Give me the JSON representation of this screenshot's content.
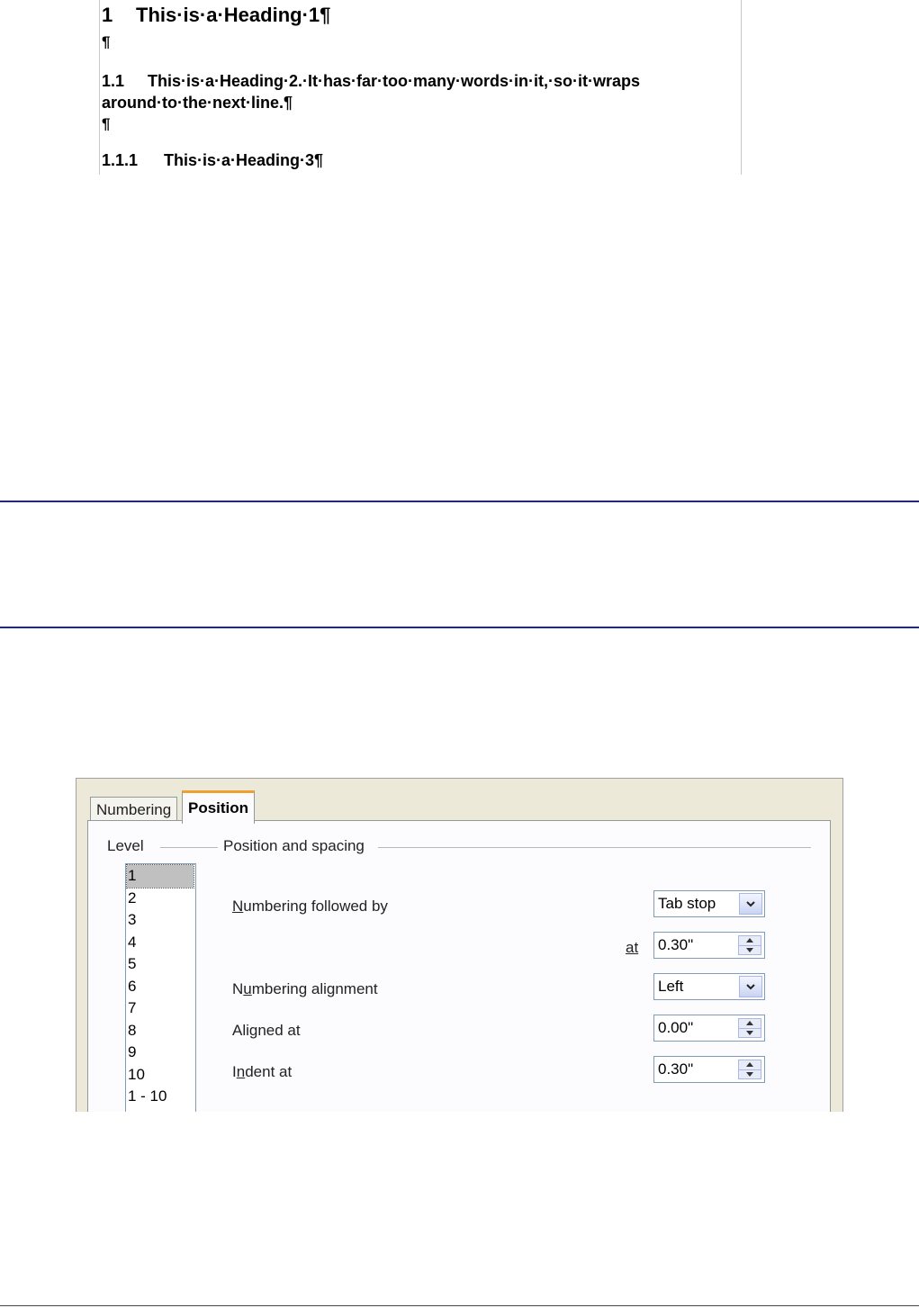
{
  "document": {
    "heading1": {
      "number": "1",
      "text": "This·is·a·Heading·1¶"
    },
    "pilcrow1": "¶",
    "heading2": {
      "number": "1.1",
      "text": "This·is·a·Heading·2.·It·has·far·too·many·words·in·it,·so·it·wraps around·to·the·next·line.¶"
    },
    "pilcrow2": "¶",
    "heading3": {
      "number": "1.1.1",
      "text": "This·is·a·Heading·3¶"
    }
  },
  "dialog": {
    "tabs": {
      "numbering": "Numbering",
      "position": "Position"
    },
    "level_label": "Level",
    "levels": [
      "1",
      "2",
      "3",
      "4",
      "5",
      "6",
      "7",
      "8",
      "9",
      "10",
      "1 - 10"
    ],
    "selected_level": "1",
    "section_label": "Position and spacing",
    "numbering_followed_by": {
      "label_u": "N",
      "label_rest": "umbering followed by",
      "value": "Tab stop"
    },
    "at": {
      "label": "at",
      "value": "0.30\""
    },
    "numbering_alignment": {
      "label_a": "N",
      "label_u": "u",
      "label_rest": "mbering alignment",
      "value": "Left"
    },
    "aligned_at": {
      "label": "Aligned at",
      "value": "0.00\""
    },
    "indent_at": {
      "label_a": "I",
      "label_u": "n",
      "label_rest": "dent at",
      "value": "0.30\""
    }
  },
  "colors": {
    "rule": "#1f2a7a",
    "dialog_bg": "#ece9d8",
    "tab_highlight": "#f0a030"
  }
}
